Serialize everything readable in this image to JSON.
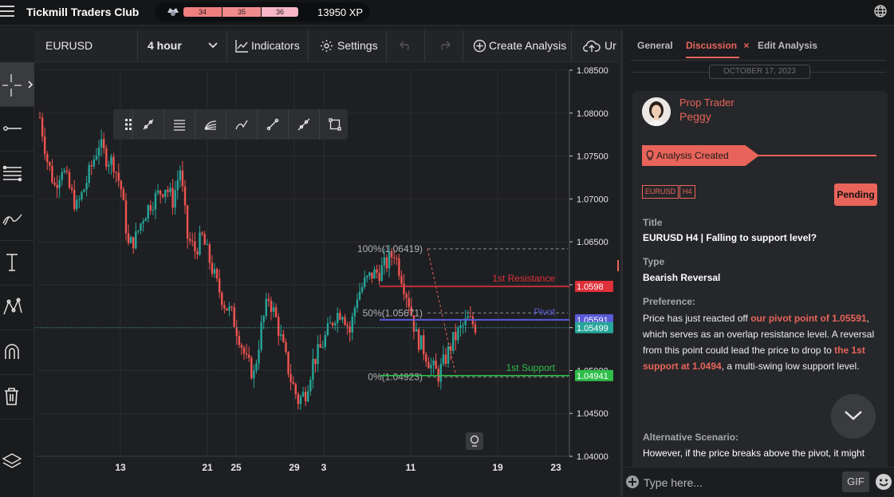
{
  "app": {
    "title": "Tickmill Traders Club"
  },
  "xp": {
    "levels": [
      "34",
      "35",
      "36"
    ],
    "total": "13950 XP"
  },
  "toolbar": {
    "symbol": "EURUSD",
    "timeframe": "4 hour",
    "indicators": "Indicators",
    "settings": "Settings",
    "create": "Create Analysis",
    "upload": "Ur"
  },
  "chart_data": {
    "type": "line",
    "symbol": "EURUSD",
    "ylim": [
      1.04,
      1.085
    ],
    "y_ticks": [
      "1.08500",
      "1.08000",
      "1.07500",
      "1.07000",
      "1.06500",
      "1.06000",
      "1.05500",
      "1.05000",
      "1.04500",
      "1.04000"
    ],
    "x_ticks": [
      "13",
      "21",
      "25",
      "29",
      "3",
      "11",
      "19",
      "23"
    ],
    "price_path": [
      1.0795,
      1.0745,
      1.0715,
      1.0738,
      1.0712,
      1.069,
      1.0712,
      1.0738,
      1.0765,
      1.0748,
      1.0742,
      1.0712,
      1.0645,
      1.0655,
      1.068,
      1.0695,
      1.0705,
      1.0715,
      1.0698,
      1.0735,
      1.0655,
      1.064,
      1.0655,
      1.0628,
      1.06,
      1.0578,
      1.0565,
      1.054,
      1.051,
      1.0495,
      1.055,
      1.0585,
      1.056,
      1.0525,
      1.049,
      1.0465,
      1.0475,
      1.051,
      1.0525,
      1.0545,
      1.0565,
      1.057,
      1.0545,
      1.0588,
      1.0602,
      1.0612,
      1.0615,
      1.0625,
      1.0638,
      1.061,
      1.058,
      1.054,
      1.0525,
      1.0505,
      1.0495,
      1.0515,
      1.0535,
      1.0548,
      1.0559,
      1.0552
    ],
    "levels": [
      {
        "name": "1st Resistance",
        "price": 1.0598,
        "label": "1.0598",
        "color": "#e0303a"
      },
      {
        "name": "Pivot",
        "price": 1.05591,
        "label": "1.05591",
        "color": "#5a5bd8"
      },
      {
        "name": "1st Support",
        "price": 1.04941,
        "label": "1.04941",
        "color": "#2fbf4a"
      }
    ],
    "current_price": {
      "price": 1.05499,
      "label": "1.05499",
      "color": "#26a69a"
    },
    "fibonacci": [
      {
        "label": "100%(1.06419)",
        "price": 1.06419
      },
      {
        "label": "50%(1.05671)",
        "price": 1.05671
      },
      {
        "label": "0%(1.04923)",
        "price": 1.04923
      }
    ]
  },
  "panel": {
    "tabs": [
      "General",
      "Discussion",
      "Edit Analysis"
    ],
    "tab_close": "×",
    "date": "OCTOBER 17, 2023",
    "role": "Prop Trader",
    "user": "Peggy",
    "created": "Analysis Created",
    "tags": [
      "EURUSD",
      "H4"
    ],
    "status": "Pending",
    "title_label": "Title",
    "title_value": "EURUSD H4 | Falling to support level?",
    "type_label": "Type",
    "type_value": "Bearish Reversal",
    "pref_label": "Preference:",
    "pref_1": "Price has just reacted off ",
    "pref_hl1": "our pivot point of 1.05591",
    "pref_2": ", which serves as an overlap resistance level. A reversal from this point could lead the price to drop to ",
    "pref_hl2": "the 1st support at 1.0494",
    "pref_3": ", a multi-swing low support level.",
    "alt_label": "Alternative Scenario:",
    "alt_text": "However, if the price breaks above the pivot, it might",
    "input_placeholder": "Type here...",
    "gif": "GIF"
  }
}
